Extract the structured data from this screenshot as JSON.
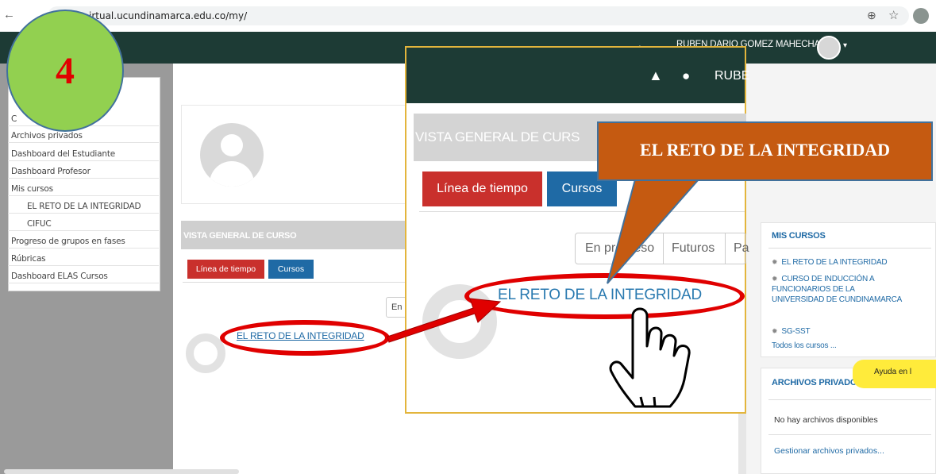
{
  "browser": {
    "back_icon": "←",
    "url": "irtual.ucundinamarca.edu.co/my/",
    "zoom_icon": "⊕",
    "star_icon": "☆"
  },
  "navbar": {
    "username": "RUBEN DARIO GOMEZ MAHECHA",
    "caret": "▾"
  },
  "sidebar": {
    "items": [
      {
        "label": "C"
      },
      {
        "label": "Archivos privados"
      },
      {
        "label": "Dashboard del Estudiante"
      },
      {
        "label": "Dashboard Profesor"
      },
      {
        "label": "Mis cursos"
      },
      {
        "label": "EL RETO DE LA INTEGRIDAD"
      },
      {
        "label": "CIFUC"
      },
      {
        "label": "Progreso de grupos en fases"
      },
      {
        "label": "Rúbricas"
      },
      {
        "label": "Dashboard ELAS Cursos"
      }
    ]
  },
  "overview": {
    "title": "VISTA GENERAL DE CURSO",
    "btn_timeline": "Línea de tiempo",
    "btn_courses": "Cursos",
    "filter_partial": "En",
    "progress_pct": "0%",
    "course_link": "EL RETO DE LA INTEGRIDAD"
  },
  "mis_cursos": {
    "title": "MIS CURSOS",
    "items": [
      "EL RETO DE LA INTEGRIDAD",
      "CURSO DE INDUCCIÓN A FUNCIONARIOS DE LA UNIVERSIDAD DE CUNDINAMARCA",
      "SG-SST"
    ],
    "all_link": "Todos los cursos ..."
  },
  "archivos": {
    "title": "ARCHIVOS PRIVADOS",
    "help_tab": "Ayuda en l",
    "empty": "No hay archivos disponibles",
    "manage": "Gestionar archivos privados..."
  },
  "zoom": {
    "user_partial": "RUBE",
    "title_partial": "VISTA GENERAL DE CURS",
    "btn_timeline": "Línea de tiempo",
    "btn_courses": "Cursos",
    "tab_in_progress": "En progreso",
    "tab_future": "Futuros",
    "tab_past_partial": "Pa",
    "course_link": "EL RETO DE LA INTEGRIDAD"
  },
  "annotation": {
    "step_number": "4",
    "callout": "EL RETO DE LA INTEGRIDAD",
    "colors": {
      "badge": "#92d050",
      "callout": "#c55a11",
      "ellipse": "#e00000",
      "navbar": "#1d3b35"
    }
  }
}
